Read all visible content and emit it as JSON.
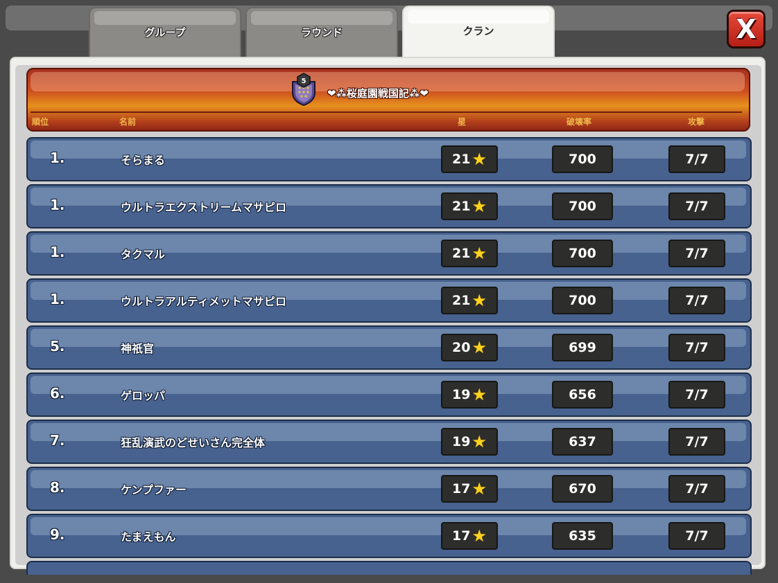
{
  "tabs": [
    {
      "label": "グループ",
      "active": false
    },
    {
      "label": "ラウンド",
      "active": false
    },
    {
      "label": "クラン",
      "active": true
    }
  ],
  "close_label": "X",
  "clan": {
    "name": "❤⁂桜庭園戦国記⁂❤",
    "level": "5"
  },
  "columns": {
    "rank": "順位",
    "name": "名前",
    "stars": "星",
    "destruction": "破壊率",
    "attacks": "攻撃"
  },
  "icons": {
    "star": "star-icon",
    "close": "close-icon",
    "clan_badge": "clan-badge-icon"
  },
  "colors": {
    "row_bg": "#47628e",
    "header_orange": "#e6901e",
    "star": "#ffd21c",
    "close_red": "#d8342a"
  },
  "players": [
    {
      "rank": "1.",
      "name": "そらまる",
      "stars": "21",
      "destruction": "700",
      "attacks": "7/7"
    },
    {
      "rank": "1.",
      "name": "ウルトラエクストリームマサピロ",
      "stars": "21",
      "destruction": "700",
      "attacks": "7/7"
    },
    {
      "rank": "1.",
      "name": "タクマル",
      "stars": "21",
      "destruction": "700",
      "attacks": "7/7"
    },
    {
      "rank": "1.",
      "name": "ウルトラアルティメットマサピロ",
      "stars": "21",
      "destruction": "700",
      "attacks": "7/7"
    },
    {
      "rank": "5.",
      "name": "神祇官",
      "stars": "20",
      "destruction": "699",
      "attacks": "7/7"
    },
    {
      "rank": "6.",
      "name": "ゲロッパ",
      "stars": "19",
      "destruction": "656",
      "attacks": "7/7"
    },
    {
      "rank": "7.",
      "name": "狂乱演武のどせいさん完全体",
      "stars": "19",
      "destruction": "637",
      "attacks": "7/7"
    },
    {
      "rank": "8.",
      "name": "ケンプファー",
      "stars": "17",
      "destruction": "670",
      "attacks": "7/7"
    },
    {
      "rank": "9.",
      "name": "たまえもん",
      "stars": "17",
      "destruction": "635",
      "attacks": "7/7"
    }
  ]
}
